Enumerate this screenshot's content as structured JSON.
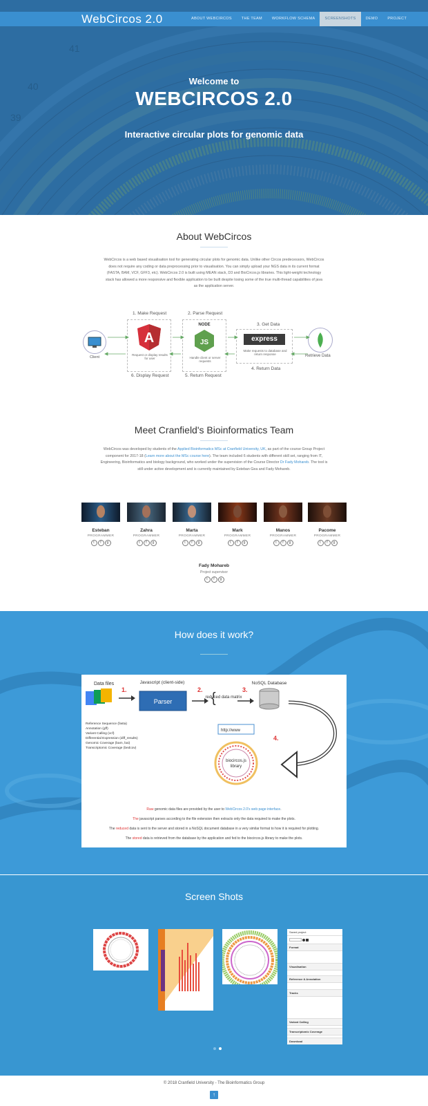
{
  "nav": {
    "brand": "WebCircos 2.0",
    "items": [
      "ABOUT WEBCIRCOS",
      "THE TEAM",
      "WORKFLOW SCHEMA",
      "SCREENSHOTS",
      "DEMO",
      "PROJECT"
    ],
    "active_index": 3
  },
  "hero": {
    "line1": "Welcome to",
    "line2": "WEBCIRCOS 2.0",
    "line3": "Interactive circular plots for genomic data"
  },
  "about": {
    "title": "About WebCircos",
    "paragraph": "WebCircos is a web based visualisation tool for generating circular plots for genomic data. Unlike other Circos predecessors, WebCircos does not require any coding or data preprocessing prior to visualisation. You can simply upload your NGS data in its current format (FASTA, BAM, VCF, GFF3, etc). WebCircos 2.0 is built using MEAN stack, D3 and BioCircos.js libraries. This light-weight technology stack has allowed a more responsive and flexible application to be built despite losing some of the true multi-thread capabilities of java as the application server.",
    "flow": {
      "step1": "1. Make Request",
      "step2": "2. Parse Request",
      "step3": "3. Get Data",
      "step4": "4. Return Data",
      "step5": "5. Return Request",
      "step6": "6. Display Request",
      "client": "Client",
      "retrieve": "Retrieve Data",
      "angular_caption": "Request or display results for user",
      "node_caption": "Handle client or server requests",
      "express_caption": "Make requests to database and return response",
      "node_label": "NODE",
      "express_label": "express"
    }
  },
  "team": {
    "title": "Meet Cranfield's Bioinformatics Team",
    "paragraph_start": "WebCircos was developed by students of the ",
    "link1": "Applied Bioinformatics MSc at Cranfield University, UK",
    "paragraph_mid1": ", as part of the course Group Project component for 2017-18 (",
    "link2": "Learn more about the MSc course here",
    "paragraph_mid2": "). The team included 6 students with different skill set, ranging from IT, Engineering, Bioinformatics and biology background, who worked under the supervision of the Course Director ",
    "link3": "Dr Fady Mohareb",
    "paragraph_end": ". The tool is still under active development and is currently maintained by Esteban Gea and Fady Mohareb.",
    "members": [
      {
        "name": "Esteban",
        "role": "PROGRAMMER"
      },
      {
        "name": "Zahra",
        "role": "PROGRAMMER"
      },
      {
        "name": "Marta",
        "role": "PROGRAMMER"
      },
      {
        "name": "Mark",
        "role": "PROGRAMMER"
      },
      {
        "name": "Manos",
        "role": "PROGRAMMER"
      },
      {
        "name": "Pacome",
        "role": "PROGRAMMER"
      }
    ],
    "supervisor": {
      "name": "Fady Mohareb",
      "role": "Project supervisor"
    }
  },
  "how": {
    "title": "How does it work?",
    "diagram": {
      "data_files": "Data files",
      "js_label": "Javascript (client-side)",
      "parser": "Parser",
      "reduced": "reduced data matrix",
      "nosql": "NoSQL Database",
      "step1": "1.",
      "step2": "2.",
      "step3": "3.",
      "step4": "4.",
      "url": "http://www",
      "lib": "biocircos.js library",
      "file_types": [
        "Reference Sequence (fasta)",
        "Annotation (gff)",
        "Variant Calling (vcf)",
        "Differential Expression (diff_results)",
        "Genomic Coverage (bam, bai)",
        "Transcriptomic Coverage (bedcov)"
      ]
    },
    "lines": [
      {
        "pre": "",
        "hl": "Raw",
        "post": " genomic data files are provided by the user to ",
        "link": "WebCircos 2.0's web page interface",
        "end": "."
      },
      {
        "pre": "",
        "hl": "The",
        "post": " javascript parses according to the file extension then extracts only the data required to make the plots.",
        "link": "",
        "end": ""
      },
      {
        "pre": "The ",
        "hl": "reduced",
        "post": " data is sent to the server and stored in a NoSQL document database in a very similar format to how it is required for plotting.",
        "link": "",
        "end": ""
      },
      {
        "pre": "The ",
        "hl": "stored",
        "post": " data is retrieved from the database by the application and fed to the biocircos.js library to make the plots.",
        "link": "",
        "end": ""
      }
    ]
  },
  "screenshots": {
    "title": "Screen Shots",
    "panel_header": "Saved project",
    "panel_rows": [
      "Format",
      "Visualisation",
      "Reference & Annotation",
      "Tracks",
      "Variant Calling",
      "Transcriptomic Coverage",
      "Download"
    ]
  },
  "footer": {
    "copyright": "© 2018 Cranfield University - The Bioinformatics Group",
    "to_top_icon": "↑"
  }
}
